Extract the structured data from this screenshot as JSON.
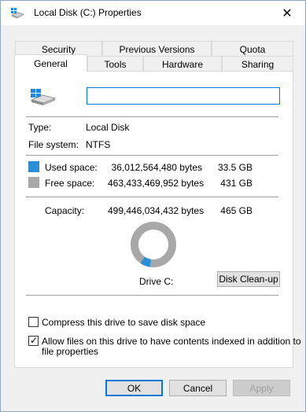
{
  "window": {
    "title": "Local Disk (C:) Properties",
    "close_glyph": "✕"
  },
  "tabs": {
    "row1": [
      "Security",
      "Previous Versions",
      "Quota"
    ],
    "row2": [
      "General",
      "Tools",
      "Hardware",
      "Sharing"
    ],
    "active": "General"
  },
  "general": {
    "name_value": "",
    "type_label": "Type:",
    "type_value": "Local Disk",
    "fs_label": "File system:",
    "fs_value": "NTFS",
    "used_label": "Used space:",
    "used_bytes": "36,012,564,480 bytes",
    "used_gb": "33.5 GB",
    "free_label": "Free space:",
    "free_bytes": "463,433,469,952 bytes",
    "free_gb": "431 GB",
    "capacity_label": "Capacity:",
    "capacity_bytes": "499,446,034,432 bytes",
    "capacity_gb": "465 GB",
    "drive_label": "Drive C:",
    "cleanup_label": "Disk Clean-up",
    "used_fraction": 0.072,
    "compress_label": "Compress this drive to save disk space",
    "compress_checked": false,
    "index_label_line1": "Allow files on this drive to have contents indexed in addition to",
    "index_label_line2": "file properties",
    "index_checked": true
  },
  "buttons": {
    "ok": "OK",
    "cancel": "Cancel",
    "apply": "Apply"
  },
  "colors": {
    "used": "#2c8fd6",
    "free": "#a8a8a8",
    "accent": "#0078d7"
  },
  "icons": {
    "title": "drive-icon",
    "header": "windows-drive-icon",
    "close": "close-icon",
    "check": "checkmark-icon"
  }
}
